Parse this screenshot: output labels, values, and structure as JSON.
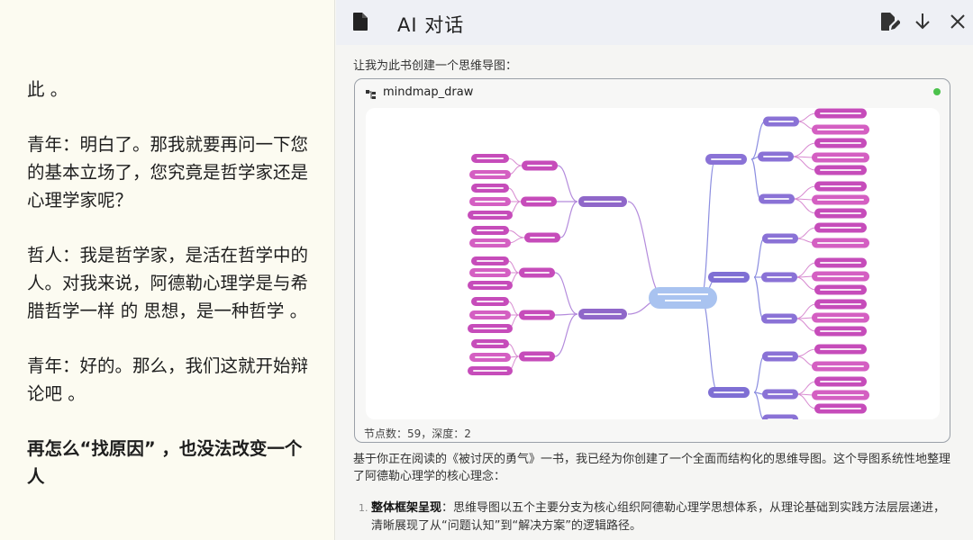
{
  "reader": {
    "paragraphs": [
      {
        "text": "此 。",
        "bold": false
      },
      {
        "text": "青年：明白了。那我就要再问一下您的基本立场了，您究竟是哲学家还是心理学家呢？",
        "bold": false
      },
      {
        "text": "哲人：我是哲学家，是活在哲学中的人。对我来说，阿德勒心理学是与希腊哲学一样 的 思想，是一种哲学 。",
        "bold": false
      },
      {
        "text": "青年：好的。那么，我们这就开始辩论吧 。",
        "bold": false
      },
      {
        "text": "再怎么“找原因” ，也没法改变一个人",
        "bold": true
      }
    ]
  },
  "chat": {
    "title": "AI 对话",
    "icons": [
      "document-icon",
      "edit-icon",
      "arrow-down-icon",
      "close-icon"
    ],
    "prompt": "让我为此书创建一个思维导图：",
    "tool": {
      "name": "mindmap_draw",
      "status_color": "#4cc24c",
      "stats": "节点数：59，深度：2"
    },
    "summary": "基于你正在阅读的《被讨厌的勇气》一书，我已经为你创建了一个全面而结构化的思维导图。这个导图系统性地整理了阿德勒心理学的核心理念：",
    "point1": {
      "number": "1.",
      "title": "整体框架呈现",
      "text": "：思维导图以五个主要分支为核心组织阿德勒心理学思想体系，从理论基础到实践方法层层递进，清晰展现了从“问题认知”到“解决方案”的逻辑路径。"
    }
  },
  "mindmap": {
    "colors": {
      "root": "#a9c3f0",
      "left": "#8f67c9",
      "right_upper": "#8a72d6",
      "right_lower": "#7f6fd4",
      "leaf": "#c64cba",
      "leaf_alt": "#d45fc2",
      "line_left": "#b48bdc",
      "line_right": "#8c8ee0"
    }
  }
}
